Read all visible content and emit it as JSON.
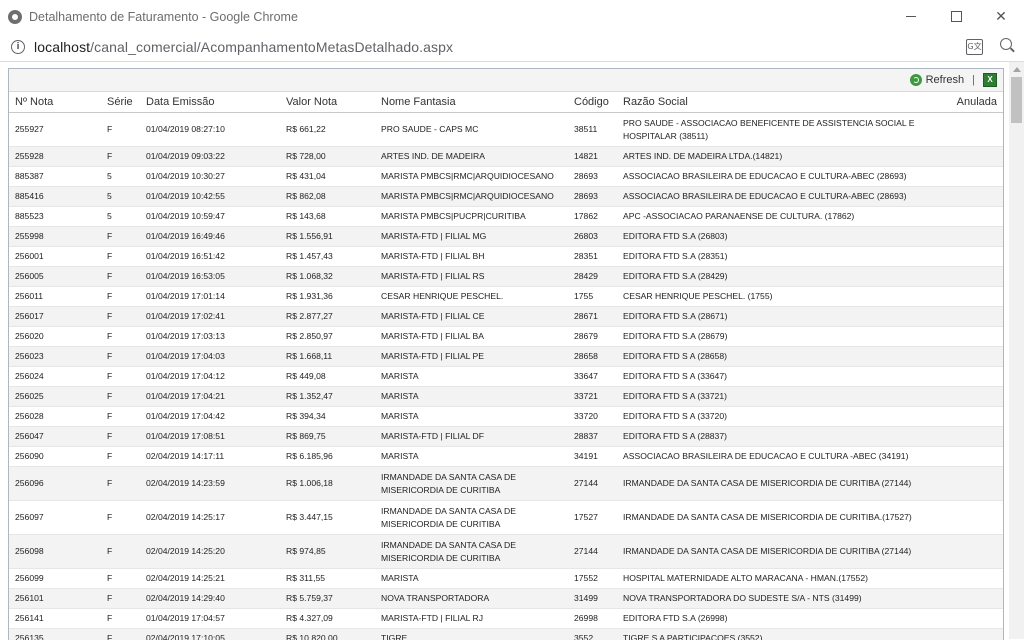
{
  "window": {
    "title": "Detalhamento de Faturamento - Google Chrome",
    "minimize": "",
    "maximize": "",
    "close": "✕"
  },
  "address": {
    "host": "localhost",
    "path": "/canal_comercial/AcompanhamentoMetasDetalhado.aspx"
  },
  "toolbar": {
    "refresh_label": "Refresh",
    "separator": "|",
    "excel_label": "X"
  },
  "columns": [
    "Nº Nota",
    "Série",
    "Data Emissão",
    "Valor Nota",
    "Nome Fantasia",
    "Código",
    "Razão Social",
    "Anulada"
  ],
  "rows": [
    {
      "nota": "255927",
      "serie": "F",
      "data": "01/04/2019 08:27:10",
      "valor": "R$ 661,22",
      "fantasia": "PRO SAUDE - CAPS MC",
      "codigo": "38511",
      "razao": "PRO SAUDE - ASSOCIACAO BENEFICENTE DE ASSISTENCIA SOCIAL E HOSPITALAR (38511)",
      "anulada": ""
    },
    {
      "nota": "255928",
      "serie": "F",
      "data": "01/04/2019 09:03:22",
      "valor": "R$ 728,00",
      "fantasia": "ARTES IND. DE MADEIRA",
      "codigo": "14821",
      "razao": "ARTES IND. DE MADEIRA LTDA.(14821)",
      "anulada": ""
    },
    {
      "nota": "885387",
      "serie": "5",
      "data": "01/04/2019 10:30:27",
      "valor": "R$ 431,04",
      "fantasia": "MARISTA PMBCS|RMC|ARQUIDIOCESANO",
      "codigo": "28693",
      "razao": "ASSOCIACAO BRASILEIRA DE EDUCACAO E CULTURA-ABEC (28693)",
      "anulada": ""
    },
    {
      "nota": "885416",
      "serie": "5",
      "data": "01/04/2019 10:42:55",
      "valor": "R$ 862,08",
      "fantasia": "MARISTA PMBCS|RMC|ARQUIDIOCESANO",
      "codigo": "28693",
      "razao": "ASSOCIACAO BRASILEIRA DE EDUCACAO E CULTURA-ABEC (28693)",
      "anulada": ""
    },
    {
      "nota": "885523",
      "serie": "5",
      "data": "01/04/2019 10:59:47",
      "valor": "R$ 143,68",
      "fantasia": "MARISTA PMBCS|PUCPR|CURITIBA",
      "codigo": "17862",
      "razao": "APC -ASSOCIACAO PARANAENSE DE CULTURA. (17862)",
      "anulada": ""
    },
    {
      "nota": "255998",
      "serie": "F",
      "data": "01/04/2019 16:49:46",
      "valor": "R$ 1.556,91",
      "fantasia": "MARISTA-FTD | FILIAL MG",
      "codigo": "26803",
      "razao": "EDITORA FTD S.A (26803)",
      "anulada": ""
    },
    {
      "nota": "256001",
      "serie": "F",
      "data": "01/04/2019 16:51:42",
      "valor": "R$ 1.457,43",
      "fantasia": "MARISTA-FTD | FILIAL BH",
      "codigo": "28351",
      "razao": "EDITORA FTD S.A (28351)",
      "anulada": ""
    },
    {
      "nota": "256005",
      "serie": "F",
      "data": "01/04/2019 16:53:05",
      "valor": "R$ 1.068,32",
      "fantasia": "MARISTA-FTD | FILIAL RS",
      "codigo": "28429",
      "razao": "EDITORA FTD S.A (28429)",
      "anulada": ""
    },
    {
      "nota": "256011",
      "serie": "F",
      "data": "01/04/2019 17:01:14",
      "valor": "R$ 1.931,36",
      "fantasia": "CESAR HENRIQUE PESCHEL.",
      "codigo": "1755",
      "razao": "CESAR HENRIQUE PESCHEL. (1755)",
      "anulada": ""
    },
    {
      "nota": "256017",
      "serie": "F",
      "data": "01/04/2019 17:02:41",
      "valor": "R$ 2.877,27",
      "fantasia": "MARISTA-FTD | FILIAL CE",
      "codigo": "28671",
      "razao": "EDITORA FTD S.A (28671)",
      "anulada": ""
    },
    {
      "nota": "256020",
      "serie": "F",
      "data": "01/04/2019 17:03:13",
      "valor": "R$ 2.850,97",
      "fantasia": "MARISTA-FTD | FILIAL BA",
      "codigo": "28679",
      "razao": "EDITORA FTD S.A (28679)",
      "anulada": ""
    },
    {
      "nota": "256023",
      "serie": "F",
      "data": "01/04/2019 17:04:03",
      "valor": "R$ 1.668,11",
      "fantasia": "MARISTA-FTD | FILIAL PE",
      "codigo": "28658",
      "razao": "EDITORA FTD S A (28658)",
      "anulada": ""
    },
    {
      "nota": "256024",
      "serie": "F",
      "data": "01/04/2019 17:04:12",
      "valor": "R$ 449,08",
      "fantasia": "MARISTA",
      "codigo": "33647",
      "razao": "EDITORA FTD S A (33647)",
      "anulada": ""
    },
    {
      "nota": "256025",
      "serie": "F",
      "data": "01/04/2019 17:04:21",
      "valor": "R$ 1.352,47",
      "fantasia": "MARISTA",
      "codigo": "33721",
      "razao": "EDITORA FTD S A (33721)",
      "anulada": ""
    },
    {
      "nota": "256028",
      "serie": "F",
      "data": "01/04/2019 17:04:42",
      "valor": "R$ 394,34",
      "fantasia": "MARISTA",
      "codigo": "33720",
      "razao": "EDITORA FTD S A (33720)",
      "anulada": ""
    },
    {
      "nota": "256047",
      "serie": "F",
      "data": "01/04/2019 17:08:51",
      "valor": "R$ 869,75",
      "fantasia": "MARISTA-FTD | FILIAL DF",
      "codigo": "28837",
      "razao": "EDITORA FTD S A (28837)",
      "anulada": ""
    },
    {
      "nota": "256090",
      "serie": "F",
      "data": "02/04/2019 14:17:11",
      "valor": "R$ 6.185,96",
      "fantasia": "MARISTA",
      "codigo": "34191",
      "razao": "ASSOCIACAO BRASILEIRA DE EDUCACAO E CULTURA -ABEC (34191)",
      "anulada": ""
    },
    {
      "nota": "256096",
      "serie": "F",
      "data": "02/04/2019 14:23:59",
      "valor": "R$ 1.006,18",
      "fantasia": "IRMANDADE DA SANTA CASA DE MISERICORDIA DE CURITIBA",
      "codigo": "27144",
      "razao": "IRMANDADE DA SANTA CASA DE MISERICORDIA DE CURITIBA (27144)",
      "anulada": ""
    },
    {
      "nota": "256097",
      "serie": "F",
      "data": "02/04/2019 14:25:17",
      "valor": "R$ 3.447,15",
      "fantasia": "IRMANDADE DA SANTA CASA DE MISERICORDIA DE CURITIBA",
      "codigo": "17527",
      "razao": "IRMANDADE DA SANTA CASA DE MISERICORDIA DE CURITIBA.(17527)",
      "anulada": ""
    },
    {
      "nota": "256098",
      "serie": "F",
      "data": "02/04/2019 14:25:20",
      "valor": "R$ 974,85",
      "fantasia": "IRMANDADE DA SANTA CASA DE MISERICORDIA DE CURITIBA",
      "codigo": "27144",
      "razao": "IRMANDADE DA SANTA CASA DE MISERICORDIA DE CURITIBA (27144)",
      "anulada": ""
    },
    {
      "nota": "256099",
      "serie": "F",
      "data": "02/04/2019 14:25:21",
      "valor": "R$ 311,55",
      "fantasia": "MARISTA",
      "codigo": "17552",
      "razao": "HOSPITAL MATERNIDADE ALTO MARACANA - HMAN.(17552)",
      "anulada": ""
    },
    {
      "nota": "256101",
      "serie": "F",
      "data": "02/04/2019 14:29:40",
      "valor": "R$ 5.759,37",
      "fantasia": "NOVA TRANSPORTADORA",
      "codigo": "31499",
      "razao": "NOVA TRANSPORTADORA DO SUDESTE S/A - NTS (31499)",
      "anulada": ""
    },
    {
      "nota": "256141",
      "serie": "F",
      "data": "01/04/2019 17:04:57",
      "valor": "R$ 4.327,09",
      "fantasia": "MARISTA-FTD | FILIAL RJ",
      "codigo": "26998",
      "razao": "EDITORA FTD S.A (26998)",
      "anulada": ""
    },
    {
      "nota": "256135",
      "serie": "F",
      "data": "02/04/2019 17:10:05",
      "valor": "R$ 10.820,00",
      "fantasia": "TIGRE",
      "codigo": "3552",
      "razao": "TIGRE S A PARTICIPACOES (3552)",
      "anulada": ""
    }
  ]
}
